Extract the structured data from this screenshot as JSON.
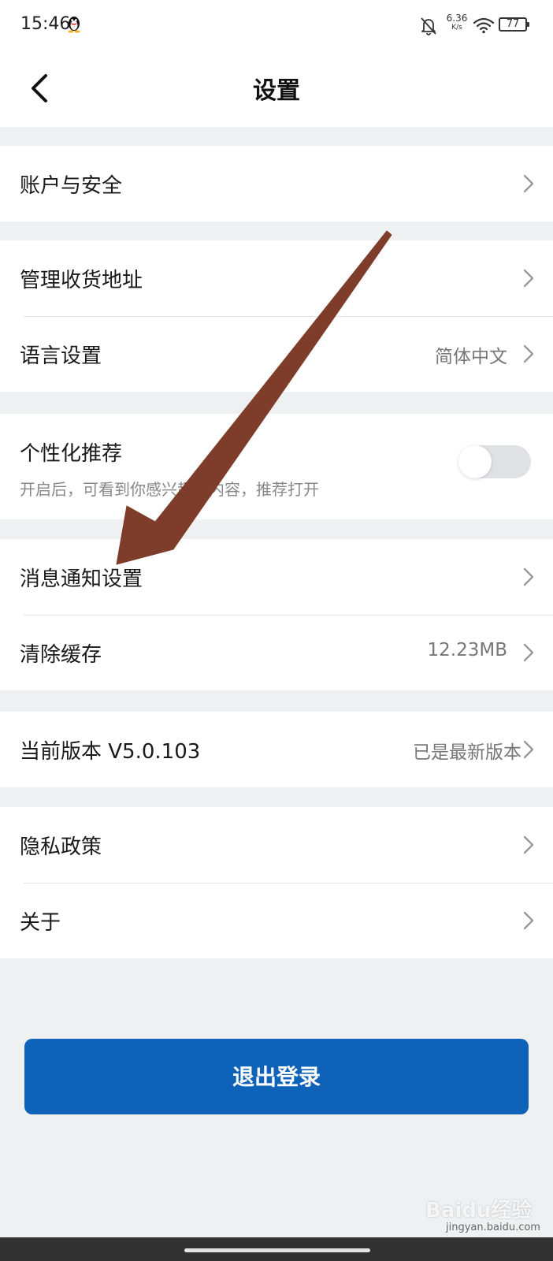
{
  "status_bar": {
    "time": "15:46",
    "net_speed_value": "6.36",
    "net_speed_unit": "K/s",
    "battery": "77"
  },
  "header": {
    "title": "设置"
  },
  "groups": {
    "account": {
      "items": [
        {
          "label": "账户与安全"
        }
      ]
    },
    "general": {
      "items": [
        {
          "label": "管理收货地址"
        },
        {
          "label": "语言设置",
          "value": "简体中文"
        }
      ]
    },
    "personalized": {
      "label": "个性化推荐",
      "description": "开启后，可看到你感兴趣的内容，推荐打开",
      "enabled": false
    },
    "misc": {
      "items": [
        {
          "label": "消息通知设置"
        },
        {
          "label": "清除缓存",
          "value": "12.23MB"
        }
      ]
    },
    "version": {
      "items": [
        {
          "label": "当前版本 V5.0.103",
          "value": "已是最新版本"
        }
      ]
    },
    "legal": {
      "items": [
        {
          "label": "隐私政策"
        },
        {
          "label": "关于"
        }
      ]
    }
  },
  "logout_label": "退出登录",
  "watermark": {
    "brand": "Baidu经验",
    "url": "jingyan.baidu.com"
  },
  "colors": {
    "primary": "#0e63b8",
    "annotation_arrow": "#7e3d2a",
    "background": "#eff0f2"
  }
}
